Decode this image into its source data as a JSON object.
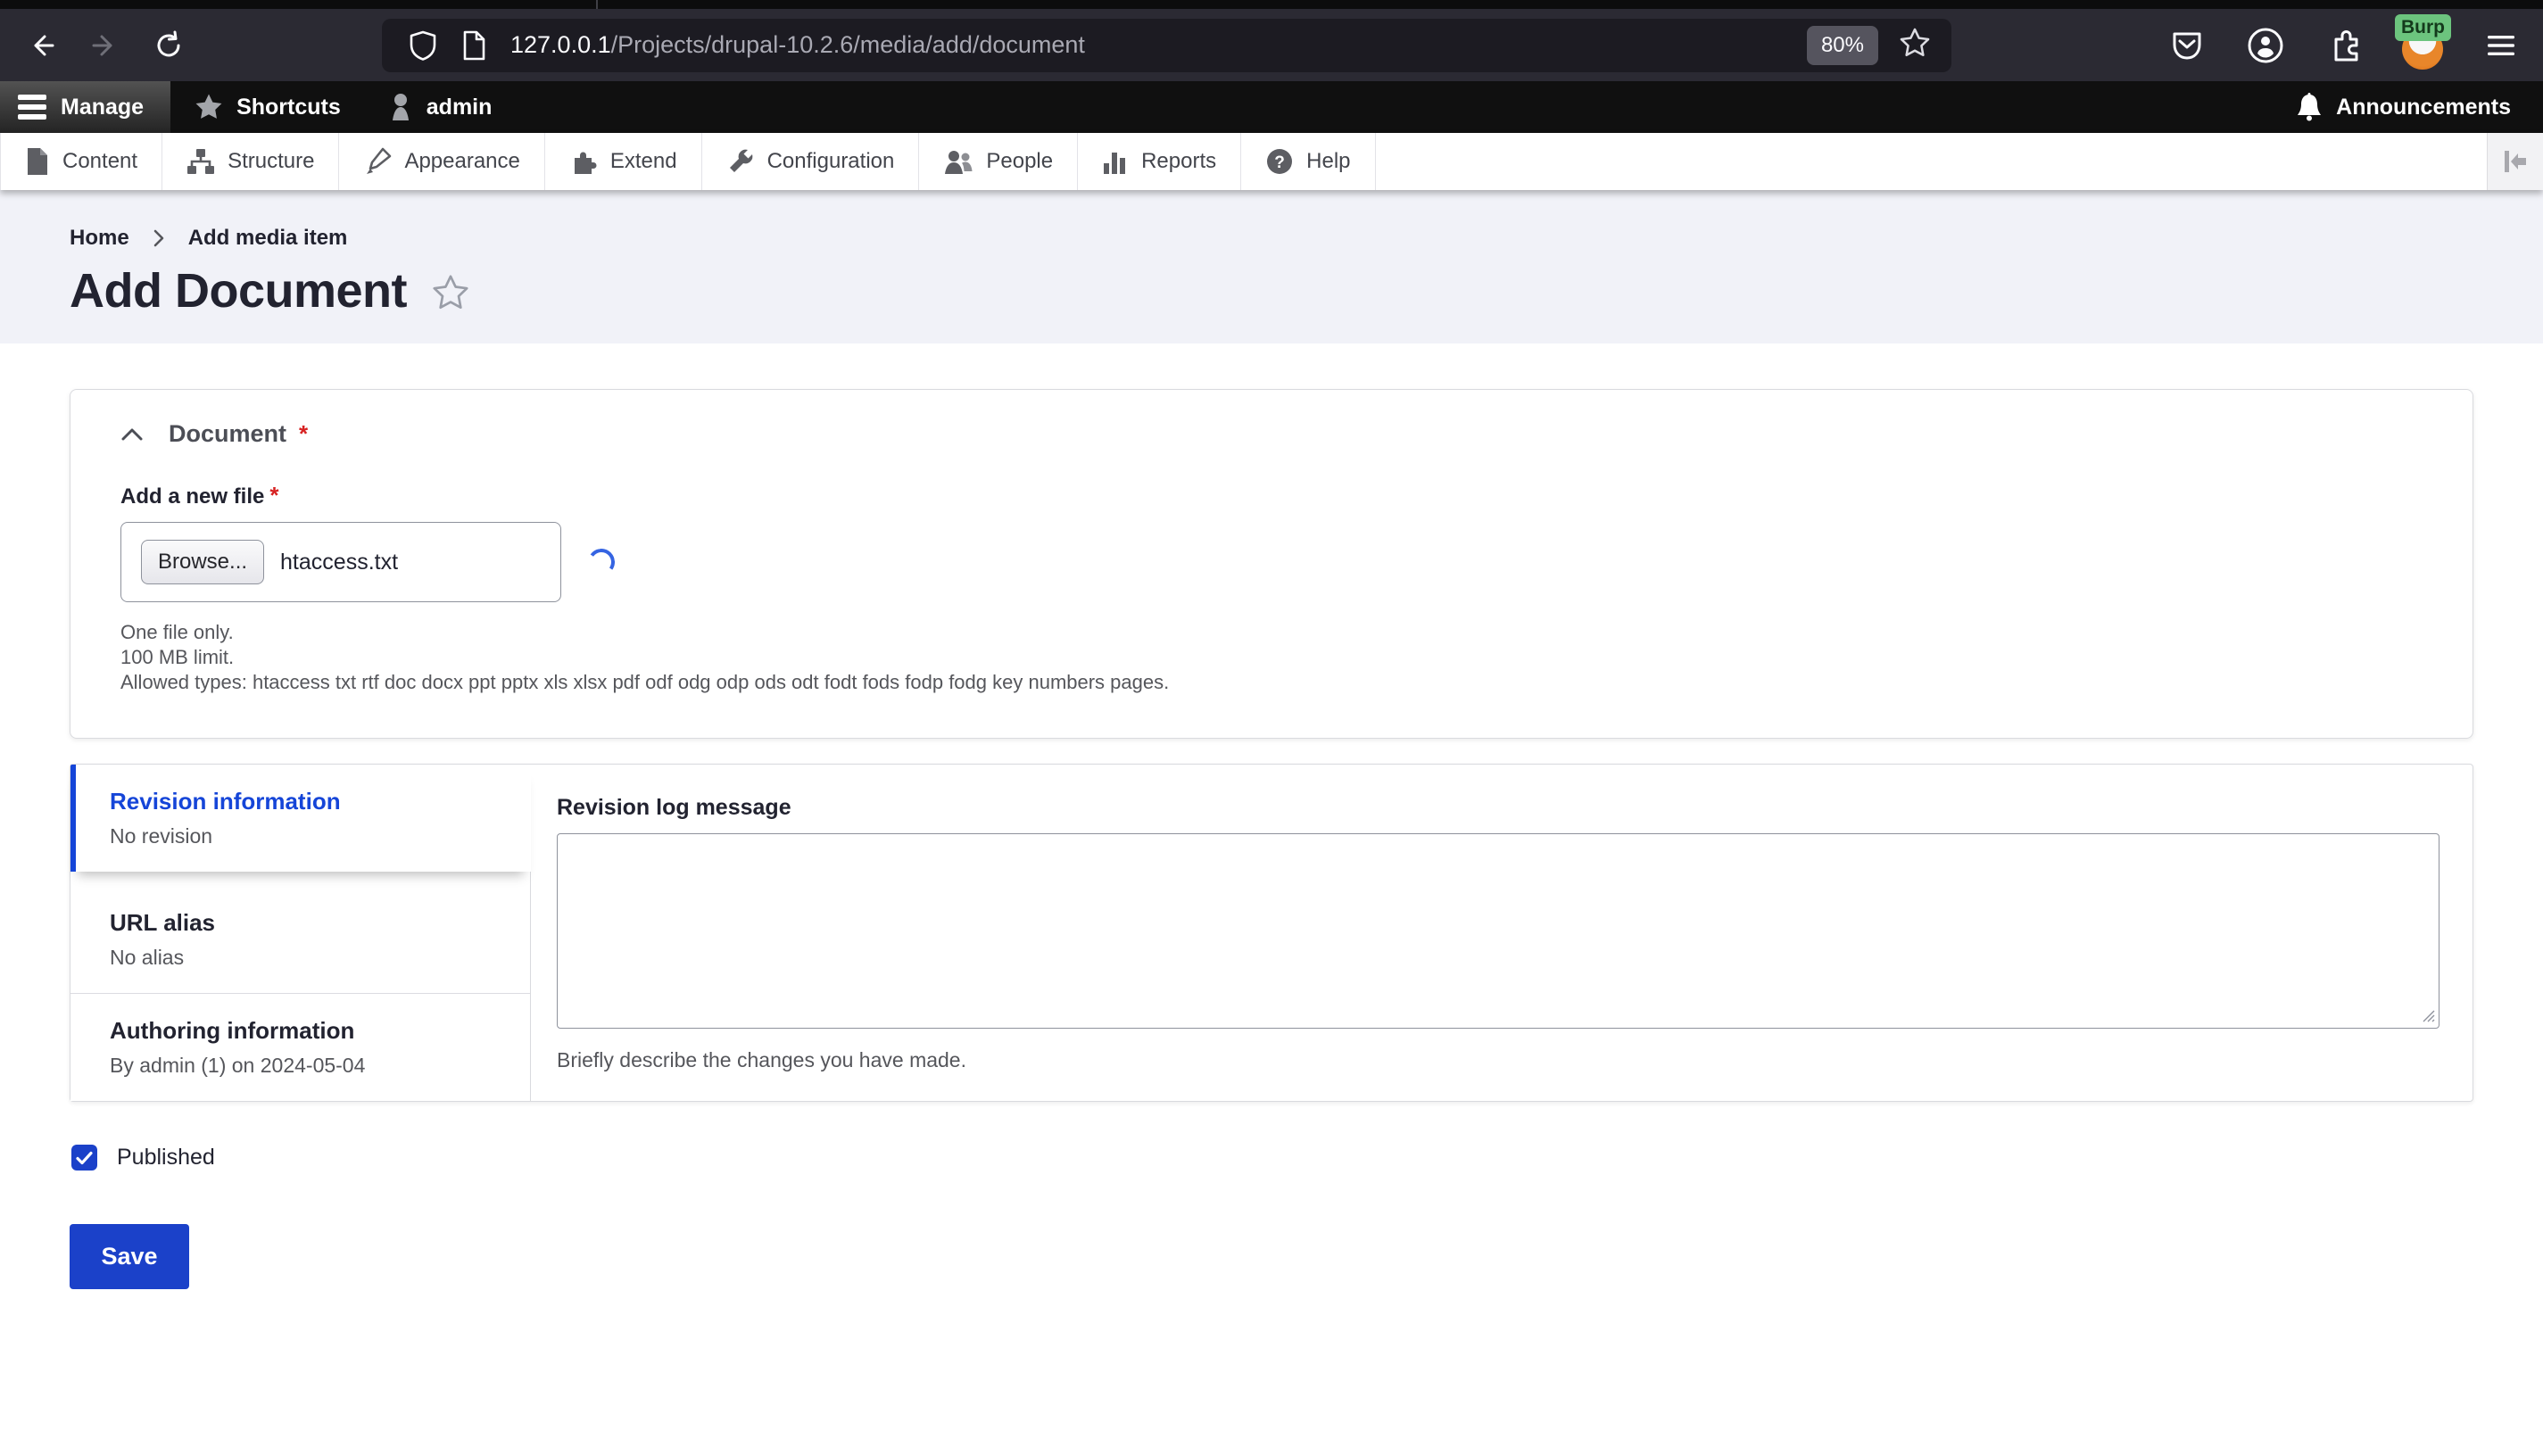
{
  "browser": {
    "url_host": "127.0.0.1",
    "url_path": "/Projects/drupal-10.2.6/media/add/document",
    "zoom_badge": "80%",
    "profile_badge": "Burp"
  },
  "admin_toolbar": {
    "manage": "Manage",
    "shortcuts": "Shortcuts",
    "user": "admin",
    "announcements": "Announcements"
  },
  "menu": {
    "items": [
      {
        "label": "Content"
      },
      {
        "label": "Structure"
      },
      {
        "label": "Appearance"
      },
      {
        "label": "Extend"
      },
      {
        "label": "Configuration"
      },
      {
        "label": "People"
      },
      {
        "label": "Reports"
      },
      {
        "label": "Help"
      }
    ]
  },
  "breadcrumb": {
    "home": "Home",
    "current": "Add media item"
  },
  "page": {
    "title": "Add Document"
  },
  "document_section": {
    "title": "Document",
    "required_marker": "*",
    "file_label": "Add a new file",
    "browse_label": "Browse...",
    "filename": "htaccess.txt",
    "hint_1": "One file only.",
    "hint_2": "100 MB limit.",
    "hint_3": "Allowed types: htaccess txt rtf doc docx ppt pptx xls xlsx pdf odf odg odp ods odt fodt fods fodp fodg key numbers pages."
  },
  "vertical_tabs": {
    "items": [
      {
        "label": "Revision information",
        "summary": "No revision",
        "active": true
      },
      {
        "label": "URL alias",
        "summary": "No alias",
        "active": false
      },
      {
        "label": "Authoring information",
        "summary": "By admin (1) on 2024-05-04",
        "active": false
      }
    ]
  },
  "revision_pane": {
    "label": "Revision log message",
    "value": "",
    "hint": "Briefly describe the changes you have made."
  },
  "publish": {
    "label": "Published",
    "checked": true
  },
  "actions": {
    "save_label": "Save"
  },
  "colors": {
    "primary_blue": "#1b41c9",
    "active_tab_blue": "#1545d8",
    "required_red": "#d72222",
    "chrome_dark": "#2b2a33",
    "admin_black": "#101010",
    "header_band": "#f1f2f8"
  }
}
